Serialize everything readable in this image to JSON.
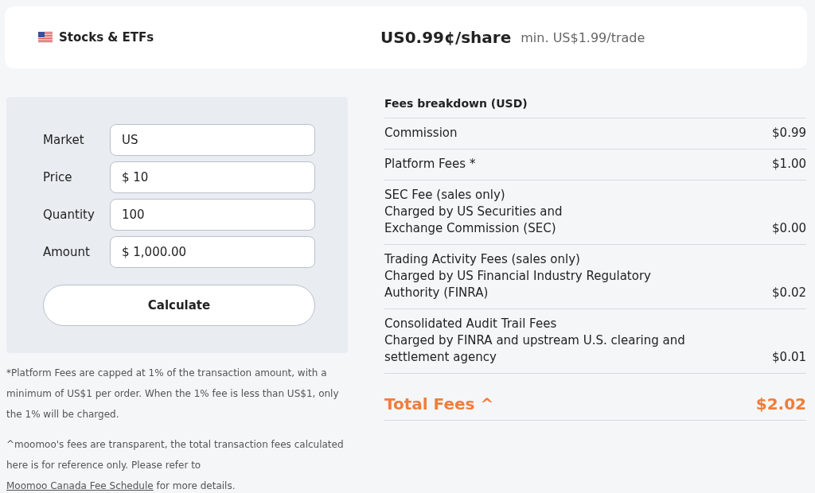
{
  "header": {
    "product": "Stocks & ETFs",
    "price": "US0.99¢/share",
    "minimum": "min. US$1.99/trade"
  },
  "calculator": {
    "fields": [
      {
        "label": "Market",
        "value": "US"
      },
      {
        "label": "Price",
        "prefix": "$",
        "value": "10"
      },
      {
        "label": "Quantity",
        "value": "100"
      },
      {
        "label": "Amount",
        "prefix": "$",
        "value": "1,000.00"
      }
    ],
    "button": "Calculate"
  },
  "notes": [
    {
      "text": "*Platform Fees are capped at 1% of the transaction amount, with a minimum of US$1 per order. When the 1% fee is less than US$1, only the 1% will be charged."
    },
    {
      "text": "^moomoo's fees are transparent, the total transaction fees calculated here is for reference only. Please refer to",
      "link": "Moomoo Canada Fee Schedule",
      "after": "for more details."
    }
  ],
  "breakdown": {
    "title": "Fees breakdown (USD)",
    "rows": [
      {
        "lines": [
          "Commission"
        ],
        "amount": "$0.99"
      },
      {
        "lines": [
          "Platform Fees *"
        ],
        "amount": "$1.00"
      },
      {
        "lines": [
          "SEC Fee (sales only)",
          "Charged by US Securities and",
          "Exchange Commission (SEC)"
        ],
        "amount": "$0.00"
      },
      {
        "lines": [
          "Trading Activity Fees (sales only)",
          "Charged by US Financial Industry Regulatory",
          "Authority (FINRA)"
        ],
        "amount": "$0.02"
      },
      {
        "lines": [
          "Consolidated Audit Trail Fees",
          "Charged by FINRA and upstream U.S. clearing and",
          "settlement agency"
        ],
        "amount": "$0.01"
      }
    ],
    "total": {
      "label": "Total Fees ^",
      "amount": "$2.02"
    }
  }
}
